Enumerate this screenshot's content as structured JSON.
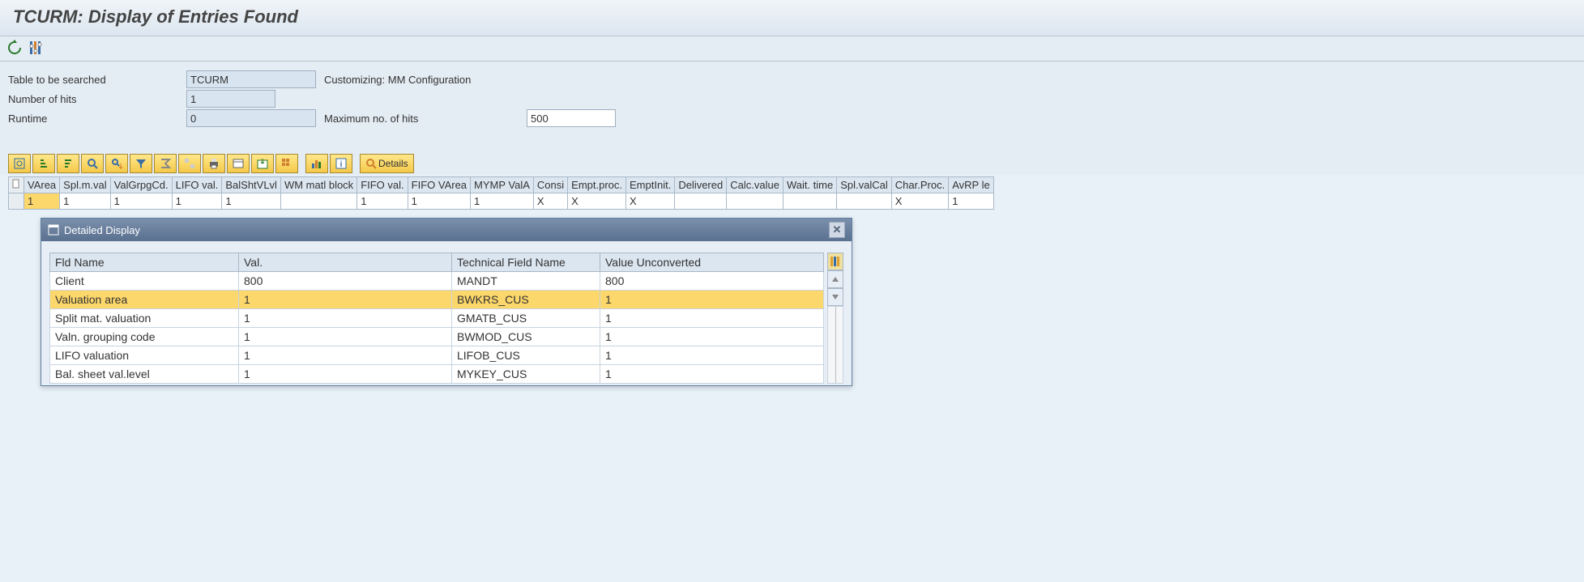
{
  "title": "TCURM: Display of Entries Found",
  "info": {
    "table_label": "Table to be searched",
    "table_value": "TCURM",
    "table_desc": "Customizing: MM Configuration",
    "hits_label": "Number of hits",
    "hits_value": "1",
    "runtime_label": "Runtime",
    "runtime_value": "0",
    "maxhits_label": "Maximum no. of hits",
    "maxhits_value": "500"
  },
  "alv": {
    "details_label": "Details",
    "columns": [
      "VArea",
      "Spl.m.val",
      "ValGrpgCd.",
      "LIFO val.",
      "BalShtVLvl",
      "WM matl block",
      "FIFO val.",
      "FIFO VArea",
      "MYMP ValA",
      "Consi",
      "Empt.proc.",
      "EmptInit.",
      "Delivered",
      "Calc.value",
      "Wait. time",
      "Spl.valCal",
      "Char.Proc.",
      "AvRP le"
    ],
    "row": [
      "1",
      "1",
      "1",
      "1",
      "1",
      "",
      "1",
      "1",
      "1",
      "X",
      "X",
      "X",
      "",
      "",
      "",
      "",
      "X",
      "1"
    ]
  },
  "dialog": {
    "title": "Detailed Display",
    "columns": [
      "Fld Name",
      "Val.",
      "Technical Field Name",
      "Value Unconverted"
    ],
    "rows": [
      {
        "fld": "Client",
        "val": "800",
        "tech": "MANDT",
        "unconv": "800",
        "hl": false
      },
      {
        "fld": "Valuation area",
        "val": "1",
        "tech": "BWKRS_CUS",
        "unconv": "1",
        "hl": true
      },
      {
        "fld": "Split mat. valuation",
        "val": "1",
        "tech": "GMATB_CUS",
        "unconv": "1",
        "hl": false
      },
      {
        "fld": "Valn. grouping code",
        "val": "1",
        "tech": "BWMOD_CUS",
        "unconv": "1",
        "hl": false
      },
      {
        "fld": "LIFO valuation",
        "val": "1",
        "tech": "LIFOB_CUS",
        "unconv": "1",
        "hl": false
      },
      {
        "fld": "Bal. sheet val.level",
        "val": "1",
        "tech": "MYKEY_CUS",
        "unconv": "1",
        "hl": false
      }
    ]
  }
}
